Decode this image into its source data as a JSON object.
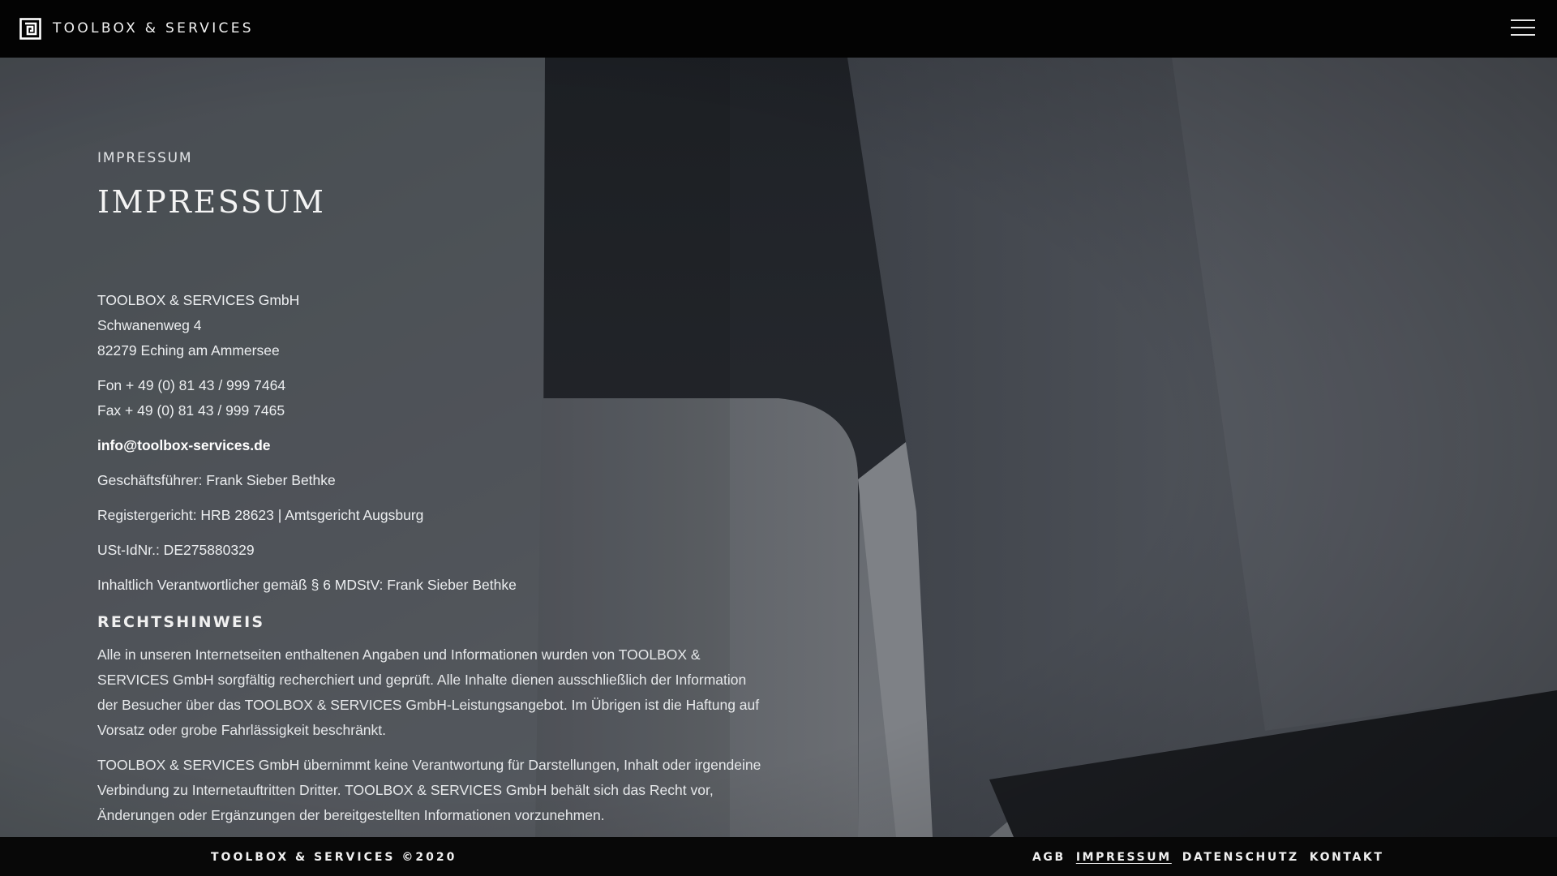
{
  "header": {
    "brand_name": "TOOLBOX & SERVICES",
    "logo_icon": "toolbox-square-spiral-icon",
    "menu_icon": "hamburger-menu-icon"
  },
  "main": {
    "eyebrow": "IMPRESSUM",
    "title": "IMPRESSUM",
    "company": "TOOLBOX & SERVICES GmbH",
    "street": "Schwanenweg 4",
    "city": "82279 Eching am Ammersee",
    "phone": "Fon + 49 (0) 81 43 / 999 7464",
    "fax": "Fax + 49 (0) 81 43 / 999 7465",
    "email": "info@toolbox-services.de",
    "managing_director": "Geschäftsführer: Frank Sieber Bethke",
    "register": "Registergericht: HRB 28623 | Amtsgericht Augsburg",
    "vat_id": "USt-IdNr.: DE275880329",
    "responsible": "Inhaltlich Verantwortlicher gemäß § 6 MDStV: Frank Sieber Bethke",
    "legal_heading": "RECHTSHINWEIS",
    "legal_paragraphs": [
      "Alle in unseren Internetseiten enthaltenen Angaben und Informationen wurden von TOOLBOX & SERVICES GmbH sorgfältig recherchiert und geprüft. Alle Inhalte dienen ausschließlich der Information der Besucher über das TOOLBOX & SERVICES GmbH-Leistungsangebot. Im Übrigen ist die Haftung auf Vorsatz oder grobe Fahrlässigkeit beschränkt.",
      "TOOLBOX & SERVICES GmbH übernimmt keine Verantwortung für Darstellungen, Inhalt oder irgendeine Verbindung zu Internetauftritten Dritter. TOOLBOX & SERVICES GmbH behält sich das Recht vor, Änderungen oder Ergänzungen der bereitgestellten Informationen vorzunehmen."
    ]
  },
  "footer": {
    "copyright": "TOOLBOX & SERVICES ©2020",
    "links": [
      {
        "label": "AGB",
        "active": false
      },
      {
        "label": "IMPRESSUM",
        "active": true
      },
      {
        "label": "DATENSCHUTZ",
        "active": false
      },
      {
        "label": "KONTAKT",
        "active": false
      }
    ]
  },
  "colors": {
    "header_bg": "#030303",
    "footer_bg": "#080808",
    "text": "#ffffff",
    "background_tone": "#5b5f66"
  }
}
